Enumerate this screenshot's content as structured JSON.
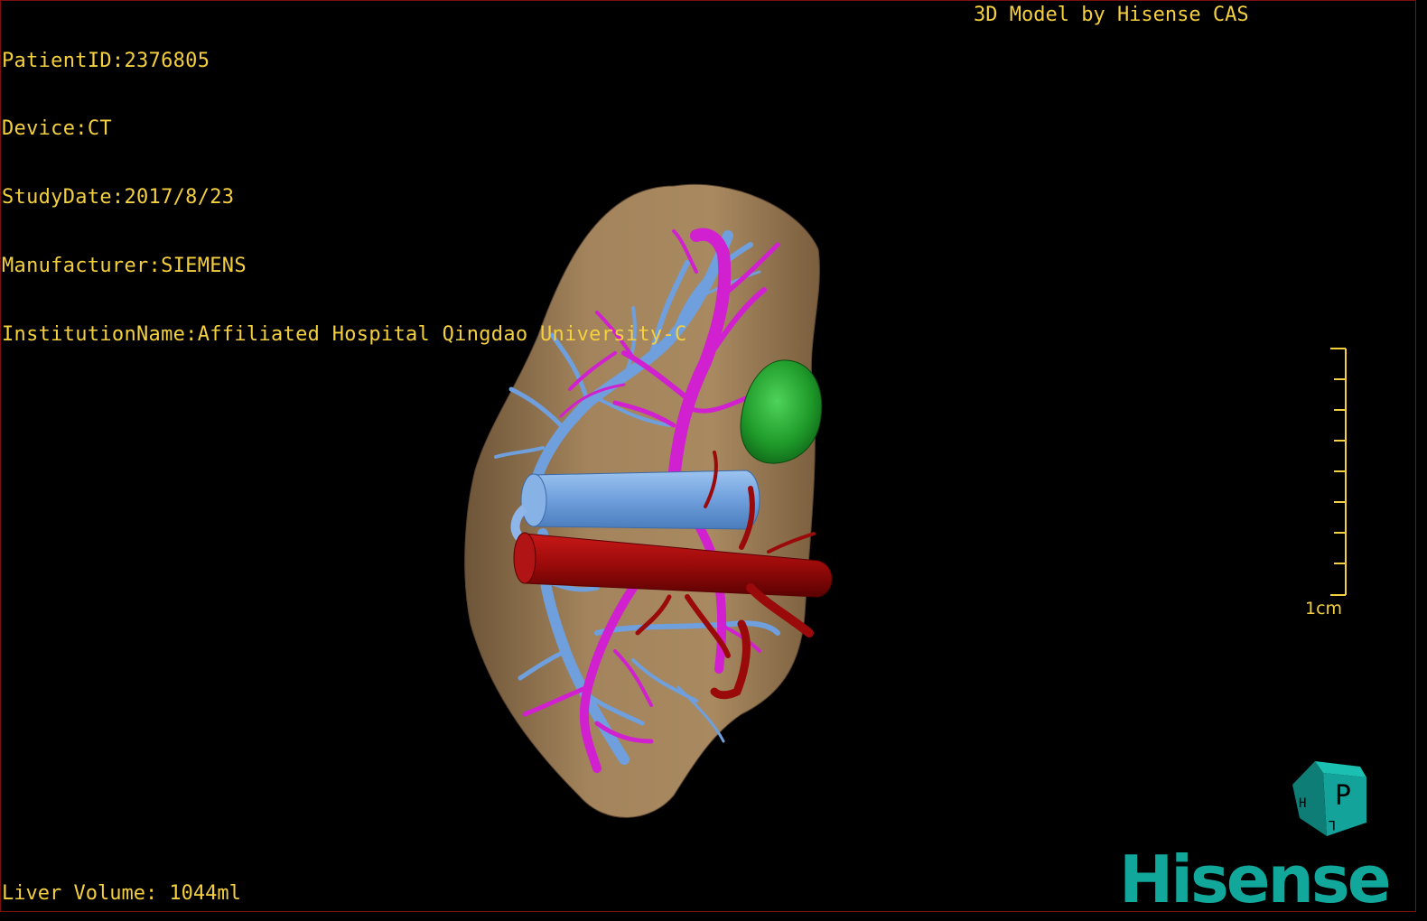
{
  "overlay": {
    "info_lines": [
      "PatientID:2376805",
      "Device:CT",
      "StudyDate:2017/8/23",
      "Manufacturer:SIEMENS",
      "InstitutionName:Affiliated Hospital Qingdao University-C"
    ],
    "credit": "3D Model by Hisense CAS",
    "volume": "Liver Volume: 1044ml"
  },
  "scale_bar": {
    "label": "1cm",
    "color": "#f4d03f"
  },
  "orientation_cube": {
    "face_letter": "P",
    "side_letter": "H",
    "bottom_letter": "L",
    "color": "#14a39a"
  },
  "brand": {
    "name": "Hisense",
    "color": "#11a89b"
  },
  "colors": {
    "background": "#000000",
    "text": "#f4d03f",
    "liver": "#a0805a",
    "portal_vein": "#6f9fdc",
    "hepatic_vein": "#d020d0",
    "artery": "#9a0a0a",
    "lesion": "#1f9a2a"
  }
}
